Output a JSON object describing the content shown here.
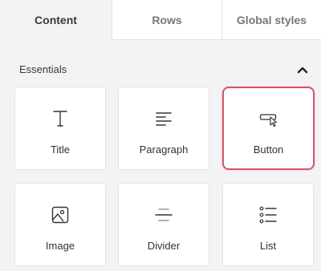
{
  "tabs": [
    {
      "label": "Content",
      "active": true
    },
    {
      "label": "Rows",
      "active": false
    },
    {
      "label": "Global styles",
      "active": false
    }
  ],
  "section": {
    "title": "Essentials",
    "collapse_icon": "chevron-up-icon"
  },
  "blocks": [
    {
      "label": "Title",
      "icon": "title-t-icon"
    },
    {
      "label": "Paragraph",
      "icon": "paragraph-lines-icon"
    },
    {
      "label": "Button",
      "icon": "button-cursor-icon",
      "selected": true
    },
    {
      "label": "Image",
      "icon": "image-icon"
    },
    {
      "label": "Divider",
      "icon": "divider-icon"
    },
    {
      "label": "List",
      "icon": "list-icon"
    }
  ],
  "colors": {
    "selected_border": "#d4566a",
    "panel_bg": "#f3f3f5",
    "tile_bg": "#ffffff"
  }
}
